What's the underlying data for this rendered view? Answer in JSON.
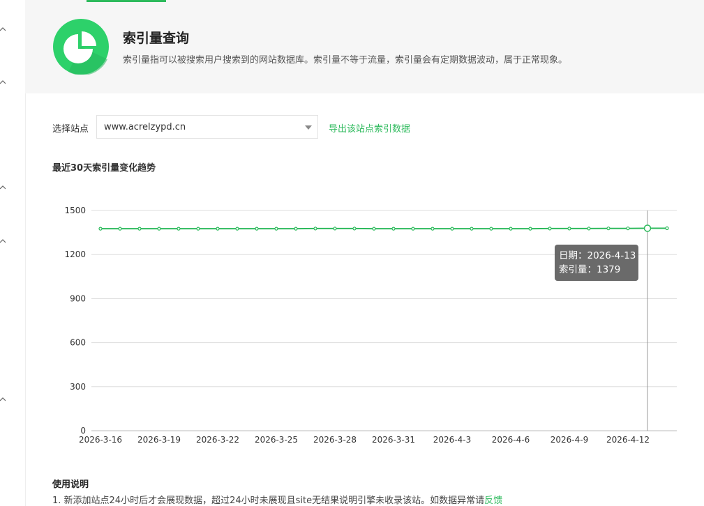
{
  "page": {
    "title": "索引量查询",
    "description": "索引量指可以被搜索用户搜索到的网站数据库。索引量不等于流量，索引量会有定期数据波动，属于正常现象。",
    "brand_color": "#2dba5c"
  },
  "site_select": {
    "label": "选择站点",
    "value": "www.acrelzypd.cn",
    "export_link": "导出该站点索引数据"
  },
  "chart_title": "最近30天索引量变化趋势",
  "tooltip": {
    "date_line": "日期：2026-4-13",
    "value_line": "索引量：1379"
  },
  "usage": {
    "title": "使用说明",
    "line1_text": "1. 新添加站点24小时后才会展现数据，超过24小时未展现且site无结果说明引擎未收录该站。如数据异常请",
    "line1_link": "反馈"
  },
  "chart_data": {
    "type": "line",
    "title": "最近30天索引量变化趋势",
    "xlabel": "",
    "ylabel": "",
    "ylim": [
      0,
      1500
    ],
    "yticks": [
      "0",
      "300",
      "600",
      "900",
      "1200",
      "1500"
    ],
    "x": [
      "2026-3-16",
      "2026-3-17",
      "2026-3-18",
      "2026-3-19",
      "2026-3-20",
      "2026-3-21",
      "2026-3-22",
      "2026-3-23",
      "2026-3-24",
      "2026-3-25",
      "2026-3-26",
      "2026-3-27",
      "2026-3-28",
      "2026-3-29",
      "2026-3-30",
      "2026-3-31",
      "2026-4-1",
      "2026-4-2",
      "2026-4-3",
      "2026-4-4",
      "2026-4-5",
      "2026-4-6",
      "2026-4-7",
      "2026-4-8",
      "2026-4-9",
      "2026-4-10",
      "2026-4-11",
      "2026-4-12",
      "2026-4-13",
      "2026-4-14"
    ],
    "xtick_labels": [
      "2026-3-16",
      "2026-3-19",
      "2026-3-22",
      "2026-3-25",
      "2026-3-28",
      "2026-3-31",
      "2026-4-3",
      "2026-4-6",
      "2026-4-9",
      "2026-4-12"
    ],
    "series": [
      {
        "values": [
          1376,
          1376,
          1376,
          1376,
          1376,
          1376,
          1376,
          1376,
          1376,
          1376,
          1376,
          1377,
          1377,
          1377,
          1376,
          1376,
          1376,
          1376,
          1376,
          1376,
          1376,
          1376,
          1376,
          1377,
          1377,
          1377,
          1378,
          1378,
          1379,
          1379
        ],
        "color": "#2dba5c"
      }
    ],
    "highlight_date": "2026-4-13",
    "grid": true
  }
}
